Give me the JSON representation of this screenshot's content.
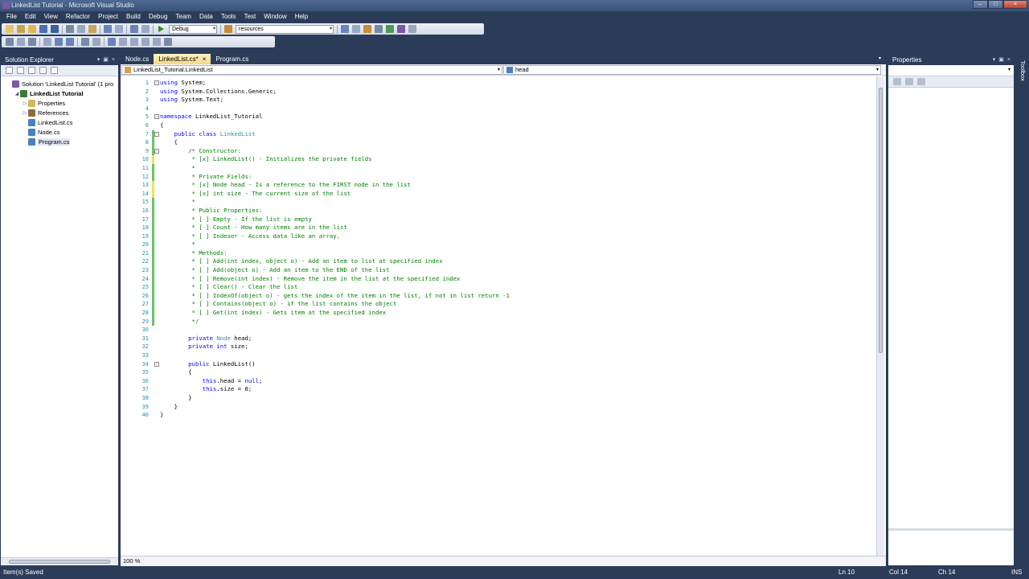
{
  "window": {
    "title": "LinkedList Tutorial - Microsoft Visual Studio",
    "buttons": [
      "–",
      "□",
      "×"
    ]
  },
  "menu": [
    "File",
    "Edit",
    "View",
    "Refactor",
    "Project",
    "Build",
    "Debug",
    "Team",
    "Data",
    "Tools",
    "Test",
    "Window",
    "Help"
  ],
  "toolbar": {
    "config_value": "Debug",
    "find_value": "resources"
  },
  "solution_explorer": {
    "title": "Solution Explorer",
    "header_controls": [
      "▾",
      "▣",
      "×"
    ],
    "items": [
      {
        "label": "Solution 'LinkedList Tutorial' (1 pro",
        "toggle": "",
        "icon": "solution-icon",
        "color": "#7b58a8",
        "bold": false,
        "indent": 0
      },
      {
        "label": "LinkedList Tutorial",
        "toggle": "◢",
        "icon": "project-icon",
        "color": "#3a7b3a",
        "bold": true,
        "indent": 1
      },
      {
        "label": "Properties",
        "toggle": "▷",
        "icon": "folder-icon",
        "color": "#d9b45a",
        "bold": false,
        "indent": 2
      },
      {
        "label": "References",
        "toggle": "▷",
        "icon": "references-icon",
        "color": "#8a6f3a",
        "bold": false,
        "indent": 2
      },
      {
        "label": "LinkedList.cs",
        "toggle": "",
        "icon": "csharp-file-icon",
        "color": "#4a7fc0",
        "bold": false,
        "indent": 2
      },
      {
        "label": "Node.cs",
        "toggle": "",
        "icon": "csharp-file-icon",
        "color": "#4a7fc0",
        "bold": false,
        "indent": 2
      },
      {
        "label": "Program.cs",
        "toggle": "",
        "icon": "csharp-file-icon",
        "color": "#4a7fc0",
        "bold": false,
        "indent": 2,
        "selected": true
      }
    ]
  },
  "editor": {
    "tabs": [
      {
        "label": "Node.cs",
        "active": false
      },
      {
        "label": "LinkedList.cs*",
        "active": true
      },
      {
        "label": "Program.cs",
        "active": false
      }
    ],
    "tab_close": "×",
    "nav_left": "LinkedList_Tutorial.LinkedList",
    "nav_right": "head",
    "zoom": "100 %",
    "line_numbers": [
      "1",
      "2",
      "3",
      "4",
      "5",
      "6",
      "7",
      "8",
      "9",
      "10",
      "11",
      "12",
      "13",
      "14",
      "15",
      "16",
      "17",
      "18",
      "19",
      "20",
      "21",
      "22",
      "23",
      "24",
      "25",
      "26",
      "27",
      "28",
      "29",
      "30",
      "31",
      "32",
      "33",
      "34",
      "35",
      "36",
      "37",
      "38",
      "39",
      "40"
    ],
    "code_lines": [
      [
        [
          "kw",
          "using"
        ],
        [
          "",
          "System;"
        ]
      ],
      [
        [
          "kw",
          "using"
        ],
        [
          "",
          "System.Collections.Generic;"
        ]
      ],
      [
        [
          "kw",
          "using"
        ],
        [
          "",
          "System.Text;"
        ]
      ],
      [],
      [
        [
          "kw",
          "namespace"
        ],
        [
          "",
          "LinkedList_Tutorial"
        ]
      ],
      [
        [
          "",
          "{"
        ]
      ],
      [
        [
          "",
          "    "
        ],
        [
          "kw",
          "public class"
        ],
        [
          "",
          " "
        ],
        [
          "ty",
          "LinkedList"
        ]
      ],
      [
        [
          "",
          "    {"
        ]
      ],
      [
        [
          "",
          "        "
        ],
        [
          "cm",
          "/* Constructor:"
        ]
      ],
      [
        [
          "",
          "         "
        ],
        [
          "cm",
          "* [x] LinkedList() - Initializes the private fields"
        ]
      ],
      [
        [
          "",
          "         "
        ],
        [
          "cm",
          "*"
        ]
      ],
      [
        [
          "",
          "         "
        ],
        [
          "cm",
          "* Private Fields:"
        ]
      ],
      [
        [
          "",
          "         "
        ],
        [
          "cm",
          "* [x] Node head - Is a reference to the FIRST node in the list"
        ]
      ],
      [
        [
          "",
          "         "
        ],
        [
          "cm",
          "* [x] int size - The current size of the list"
        ]
      ],
      [
        [
          "",
          "         "
        ],
        [
          "cm",
          "*"
        ]
      ],
      [
        [
          "",
          "         "
        ],
        [
          "cm",
          "* Public Properties:"
        ]
      ],
      [
        [
          "",
          "         "
        ],
        [
          "cm",
          "* [ ] Empty - If the list is empty"
        ]
      ],
      [
        [
          "",
          "         "
        ],
        [
          "cm",
          "* [ ] Count - How many items are in the list"
        ]
      ],
      [
        [
          "",
          "         "
        ],
        [
          "cm",
          "* [ ] Indexer - Access data like an array."
        ]
      ],
      [
        [
          "",
          "         "
        ],
        [
          "cm",
          "*"
        ]
      ],
      [
        [
          "",
          "         "
        ],
        [
          "cm",
          "* Methods:"
        ]
      ],
      [
        [
          "",
          "         "
        ],
        [
          "cm",
          "* [ ] Add(int index, object o) - Add an item to list at specified index"
        ]
      ],
      [
        [
          "",
          "         "
        ],
        [
          "cm",
          "* [ ] Add(object o) - Add an item to the END of the list"
        ]
      ],
      [
        [
          "",
          "         "
        ],
        [
          "cm",
          "* [ ] Remove(int index) - Remove the item in the list at the specified index"
        ]
      ],
      [
        [
          "",
          "         "
        ],
        [
          "cm",
          "* [ ] Clear() - Clear the list"
        ]
      ],
      [
        [
          "",
          "         "
        ],
        [
          "cm",
          "* [ ] IndexOf(object o) - gets the index of the item in the list, if not in list return -1"
        ]
      ],
      [
        [
          "",
          "         "
        ],
        [
          "cm",
          "* [ ] Contains(object o) - if the list contains the object"
        ]
      ],
      [
        [
          "",
          "         "
        ],
        [
          "cm",
          "* [ ] Get(int index) - Gets item at the specified index"
        ]
      ],
      [
        [
          "",
          "         "
        ],
        [
          "cm",
          "*/"
        ]
      ],
      [],
      [
        [
          "",
          "        "
        ],
        [
          "kw",
          "private"
        ],
        [
          "",
          " "
        ],
        [
          "ty",
          "Node"
        ],
        [
          "",
          " head;"
        ]
      ],
      [
        [
          "",
          "        "
        ],
        [
          "kw",
          "private int"
        ],
        [
          "",
          " size;"
        ]
      ],
      [],
      [
        [
          "",
          "        "
        ],
        [
          "kw",
          "public"
        ],
        [
          "",
          " LinkedList()"
        ]
      ],
      [
        [
          "",
          "        {"
        ]
      ],
      [
        [
          "",
          "            "
        ],
        [
          "kw",
          "this"
        ],
        [
          "",
          ".head = "
        ],
        [
          "kw",
          "null"
        ],
        [
          "",
          ";"
        ]
      ],
      [
        [
          "",
          "            "
        ],
        [
          "kw",
          "this"
        ],
        [
          "",
          ".size = 0;"
        ]
      ],
      [
        [
          "",
          "        }"
        ]
      ],
      [
        [
          "",
          "    }"
        ]
      ],
      [
        [
          "",
          "}"
        ]
      ]
    ]
  },
  "properties": {
    "title": "Properties",
    "header_controls": [
      "▾",
      "▣",
      "×"
    ]
  },
  "side_tab": "Toolbox",
  "status": {
    "message": "Item(s) Saved",
    "ln": "Ln 10",
    "col": "Col 14",
    "ch": "Ch 14",
    "mode": "INS"
  },
  "colors": {
    "keyword": "#0000ff",
    "type": "#2b91af",
    "comment": "#008000",
    "chrome": "#2b3c59",
    "active_tab": "#f5d885"
  }
}
